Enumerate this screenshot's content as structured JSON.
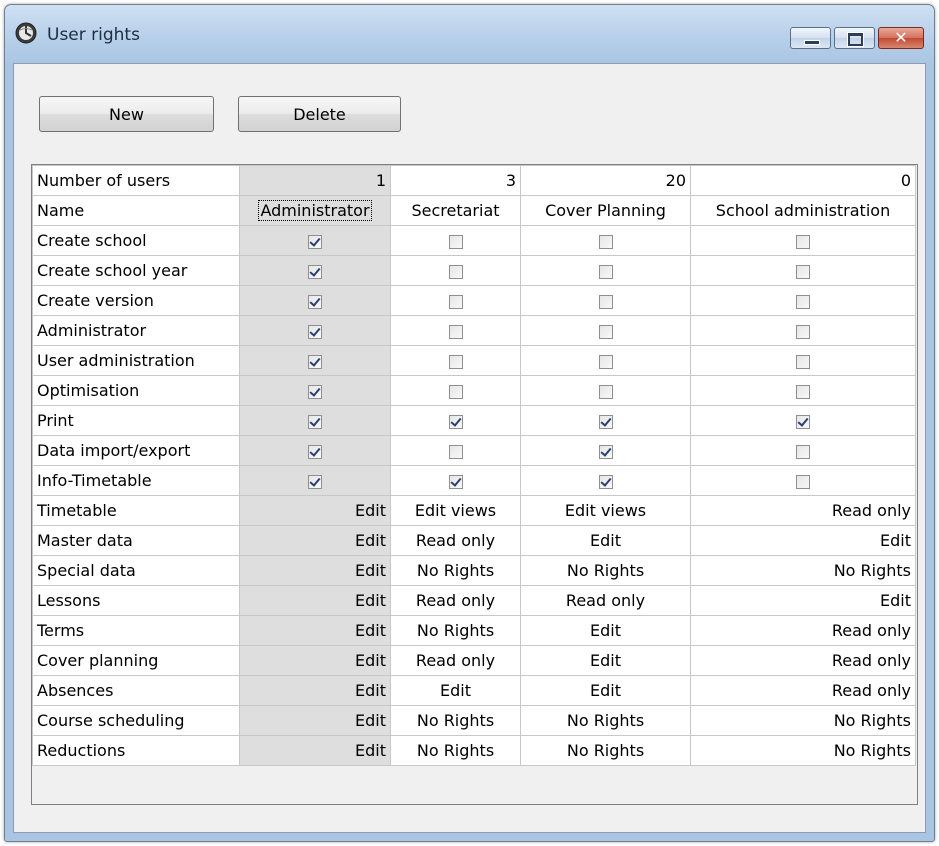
{
  "window": {
    "title": "User rights"
  },
  "toolbar": {
    "new_label": "New",
    "delete_label": "Delete"
  },
  "table": {
    "count_row_label": "Number of users",
    "name_row_label": "Name",
    "user_counts": [
      "1",
      "3",
      "20",
      "0"
    ],
    "user_names": [
      "Administrator",
      "Secretariat",
      "Cover Planning",
      "School administration"
    ],
    "checkbox_rows": [
      {
        "label": "Create school",
        "values": [
          true,
          false,
          false,
          false
        ]
      },
      {
        "label": "Create school year",
        "values": [
          true,
          false,
          false,
          false
        ]
      },
      {
        "label": "Create version",
        "values": [
          true,
          false,
          false,
          false
        ]
      },
      {
        "label": "Administrator",
        "values": [
          true,
          false,
          false,
          false
        ]
      },
      {
        "label": "User administration",
        "values": [
          true,
          false,
          false,
          false
        ]
      },
      {
        "label": "Optimisation",
        "values": [
          true,
          false,
          false,
          false
        ]
      },
      {
        "label": "Print",
        "values": [
          true,
          true,
          true,
          true
        ]
      },
      {
        "label": "Data import/export",
        "values": [
          true,
          false,
          true,
          false
        ]
      },
      {
        "label": "Info-Timetable",
        "values": [
          true,
          true,
          true,
          false
        ]
      }
    ],
    "rights_rows": [
      {
        "label": "Timetable",
        "values": [
          "Edit",
          "Edit views",
          "Edit views",
          "Read only"
        ]
      },
      {
        "label": "Master data",
        "values": [
          "Edit",
          "Read only",
          "Edit",
          "Edit"
        ]
      },
      {
        "label": "Special data",
        "values": [
          "Edit",
          "No Rights",
          "No Rights",
          "No Rights"
        ]
      },
      {
        "label": "Lessons",
        "values": [
          "Edit",
          "Read only",
          "Read only",
          "Edit"
        ]
      },
      {
        "label": "Terms",
        "values": [
          "Edit",
          "No Rights",
          "Edit",
          "Read only"
        ]
      },
      {
        "label": "Cover planning",
        "values": [
          "Edit",
          "Read only",
          "Edit",
          "Read only"
        ]
      },
      {
        "label": "Absences",
        "values": [
          "Edit",
          "Edit",
          "Edit",
          "Read only"
        ]
      },
      {
        "label": "Course scheduling",
        "values": [
          "Edit",
          "No Rights",
          "No Rights",
          "No Rights"
        ]
      },
      {
        "label": "Reductions",
        "values": [
          "Edit",
          "No Rights",
          "No Rights",
          "No Rights"
        ]
      }
    ]
  }
}
